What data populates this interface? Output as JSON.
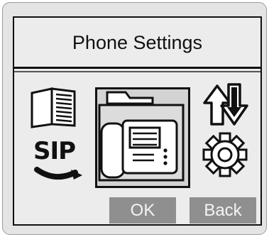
{
  "window": {
    "title": "Phone Settings"
  },
  "menu": {
    "items": [
      {
        "icon": "phonebook-icon"
      },
      {
        "icon": "sip-icon",
        "label": "SIP"
      },
      {
        "icon": "desk-phone-icon"
      },
      {
        "icon": "transfer-arrows-icon"
      },
      {
        "icon": "gear-icon"
      }
    ],
    "selected": "desk-phone-icon"
  },
  "buttons": {
    "ok": "OK",
    "back": "Back"
  },
  "colors": {
    "frame": "#e4e4e4",
    "screen": "#ececec",
    "selection": "#d3d3d3",
    "button": "#8f8f8f",
    "button_text": "#f4f4f4",
    "ink": "#111111"
  }
}
